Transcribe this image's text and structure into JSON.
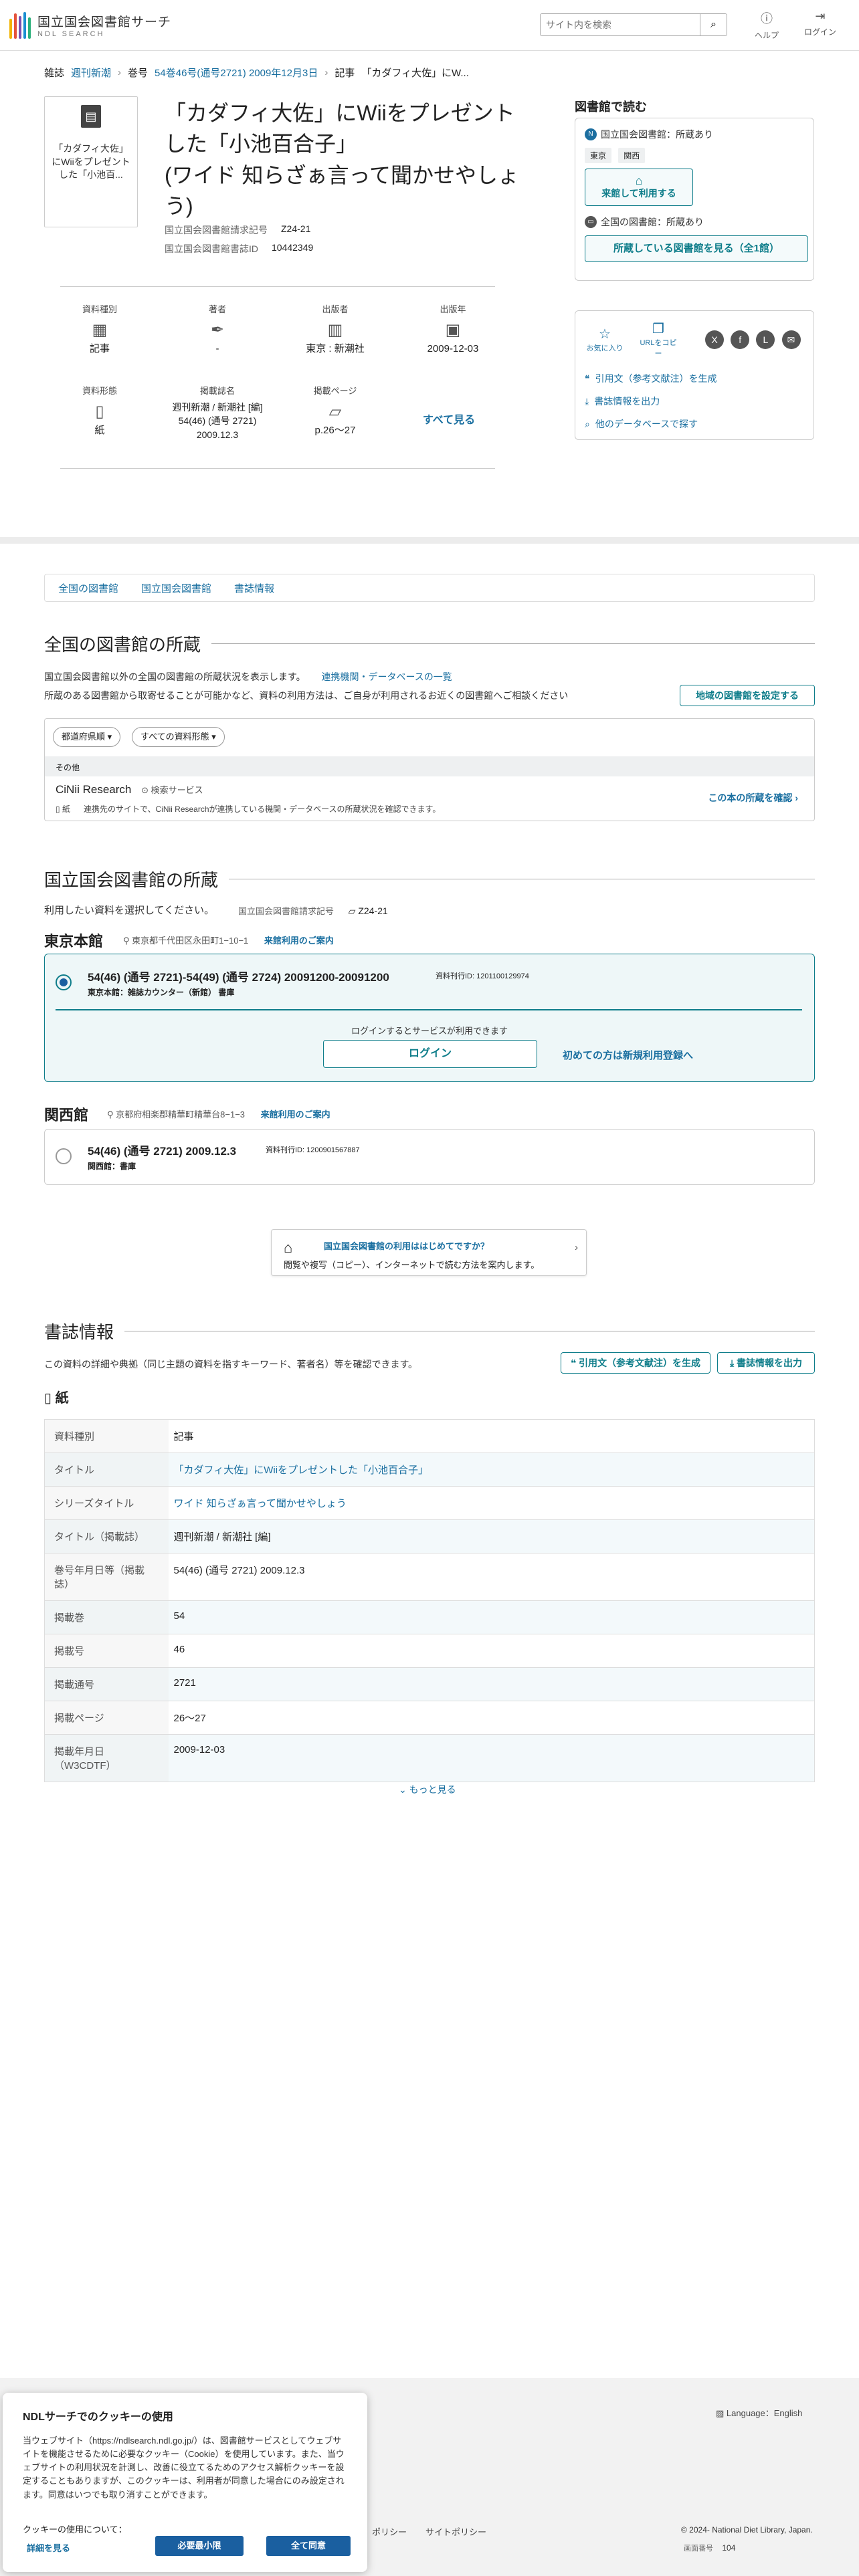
{
  "header": {
    "logo_line1": "国立国会図書館サーチ",
    "logo_line2": "NDL SEARCH",
    "search_placeholder": "サイト内を検索",
    "help_label": "ヘルプ",
    "login_label": "ログイン"
  },
  "breadcrumb": {
    "magazine_label": "雑誌",
    "magazine_link": "週刊新潮",
    "issue_label": "巻号",
    "issue_link": "54巻46号(通号2721) 2009年12月3日",
    "article_label": "記事",
    "article_current": "「カダフィ大佐」にW..."
  },
  "article": {
    "thumb_text": "「カダフィ大佐」にWiiをプレゼント した「小池百...",
    "title_lines": [
      "「カダフィ大佐」にWiiをプレゼント",
      "した「小池百合子」",
      "(ワイド 知らざぁ言って聞かせやしょ",
      "う)"
    ],
    "call_number_label": "国立国会図書館請求記号",
    "call_number": "Z24-21",
    "bib_id_label": "国立国会図書館書誌ID",
    "bib_id": "10442349"
  },
  "props": [
    {
      "label": "資料種別",
      "icon": "document-icon",
      "value": "記事"
    },
    {
      "label": "著者",
      "icon": "pen-icon",
      "value": "-"
    },
    {
      "label": "出版者",
      "icon": "building-icon",
      "value": "東京 : 新潮社"
    },
    {
      "label": "出版年",
      "icon": "calendar-icon",
      "value": "2009-12-03"
    },
    {
      "label": "資料形態",
      "icon": "paper-icon",
      "value": "紙"
    },
    {
      "label": "掲載誌名",
      "icon": "",
      "value": "週刊新潮 / 新潮社 [編]\n54(46) (通号 2721)\n2009.12.3"
    },
    {
      "label": "掲載ページ",
      "icon": "page-icon",
      "value": "p.26〜27"
    }
  ],
  "props_see_all": "すべて見る",
  "sidebar": {
    "heading": "図書館で読む",
    "ndl_holding": "国立国会図書館：所蔵あり",
    "tags": [
      "東京",
      "関西"
    ],
    "visit_button": "来館して利用する",
    "national_holding": "全国の図書館：所蔵あり",
    "libraries_button": "所蔵している図書館を見る（全1館）",
    "favorite_label": "お気に入り",
    "copy_url_label": "URLをコピー",
    "cite_link": "引用文（参考文献注）を生成",
    "export_link": "書誌情報を出力",
    "other_db_link": "他のデータベースで探す"
  },
  "tabs": [
    "全国の図書館",
    "国立国会図書館",
    "書誌情報"
  ],
  "national": {
    "heading": "全国の図書館の所蔵",
    "desc1": "国立国会図書館以外の全国の図書館の所蔵状況を表示します。",
    "desc1_link": "連携機関・データベースの一覧",
    "desc2": "所蔵のある図書館から取寄せることが可能かなど、資料の利用方法は、ご自身が利用されるお近くの図書館へご相談ください",
    "region_button": "地域の図書館を設定する",
    "filter_pref": "都道府県順",
    "filter_form": "すべての資料形態",
    "other_label": "その他",
    "cinii_name": "CiNii Research",
    "cinii_tag": "検索サービス",
    "cinii_form": "紙",
    "cinii_desc": "連携先のサイトで、CiNii Researchが連携している機関・データベースの所蔵状況を確認できます。",
    "cinii_link": "この本の所蔵を確認"
  },
  "ndl": {
    "heading": "国立国会図書館の所蔵",
    "select_prompt": "利用したい資料を選択してください。",
    "call_label": "国立国会図書館請求記号",
    "call_value": "Z24-21",
    "tokyo": {
      "name": "東京本館",
      "address": "東京都千代田区永田町1−10−1",
      "guide": "来館利用のご案内",
      "item_title": "54(46) (通号 2721)-54(49) (通号 2724) 20091200-20091200",
      "item_id": "資料刊行ID: 1201100129974",
      "item_loc": "東京本館：雑誌カウンター（新館） 書庫",
      "login_note": "ログインするとサービスが利用できます",
      "login_button": "ログイン",
      "register_link": "初めての方は新規利用登録へ"
    },
    "kansai": {
      "name": "関西館",
      "address": "京都府相楽郡精華町精華台8−1−3",
      "guide": "来館利用のご案内",
      "item_title": "54(46) (通号 2721) 2009.12.3",
      "item_id": "資料刊行ID: 1200901567887",
      "item_loc": "関西館：書庫"
    }
  },
  "guide_box": {
    "title": "国立国会図書館の利用ははじめてですか？",
    "desc": "閲覧や複写（コピー）、インターネットで読む方法を案内します。"
  },
  "biblio": {
    "heading": "書誌情報",
    "desc": "この資料の詳細や典拠（同じ主題の資料を指すキーワード、著者名）等を確認できます。",
    "cite_button": "引用文（参考文献注）を生成",
    "export_button": "書誌情報を出力",
    "form_label": "紙",
    "rows": [
      {
        "k": "資料種別",
        "v": "記事",
        "link": false
      },
      {
        "k": "タイトル",
        "v": "「カダフィ大佐」にWiiをプレゼントした「小池百合子」",
        "link": true
      },
      {
        "k": "シリーズタイトル",
        "v": "ワイド 知らざぁ言って聞かせやしょう",
        "link": true
      },
      {
        "k": "タイトル（掲載誌）",
        "v": "週刊新潮 / 新潮社 [編]",
        "link": false
      },
      {
        "k": "巻号年月日等（掲載誌）",
        "v": "54(46) (通号 2721) 2009.12.3",
        "link": false
      },
      {
        "k": "掲載巻",
        "v": "54",
        "link": false
      },
      {
        "k": "掲載号",
        "v": "46",
        "link": false
      },
      {
        "k": "掲載通号",
        "v": "2721",
        "link": false
      },
      {
        "k": "掲載ページ",
        "v": "26〜27",
        "link": false
      },
      {
        "k": "掲載年月日（W3CDTF）",
        "v": "2009-12-03",
        "link": false
      }
    ],
    "more": "もっと見る"
  },
  "footer": {
    "language": "Language：English",
    "policy1": "ポリシー",
    "policy2": "サイトポリシー",
    "copyright": "© 2024- National Diet Library, Japan.",
    "screen_no_label": "画面番号",
    "screen_no": "104"
  },
  "cookie": {
    "title": "NDLサーチでのクッキーの使用",
    "body": "当ウェブサイト（https://ndlsearch.ndl.go.jp/）は、図書館サービスとしてウェブサイトを機能させるために必要なクッキー（Cookie）を使用しています。また、当ウェブサイトの利用状況を計測し、改善に役立てるためのアクセス解析クッキーを設定することもありますが、このクッキーは、利用者が同意した場合にのみ設定されます。同意はいつでも取り消すことができます。",
    "about_label": "クッキーの使用について：",
    "details_link": "詳細を見る",
    "necessary_button": "必要最小限",
    "accept_button": "全て同意"
  },
  "colors": {
    "teal": "#0e7d8a",
    "link": "#1a6fa0",
    "selected_bg": "#eef7f8"
  }
}
